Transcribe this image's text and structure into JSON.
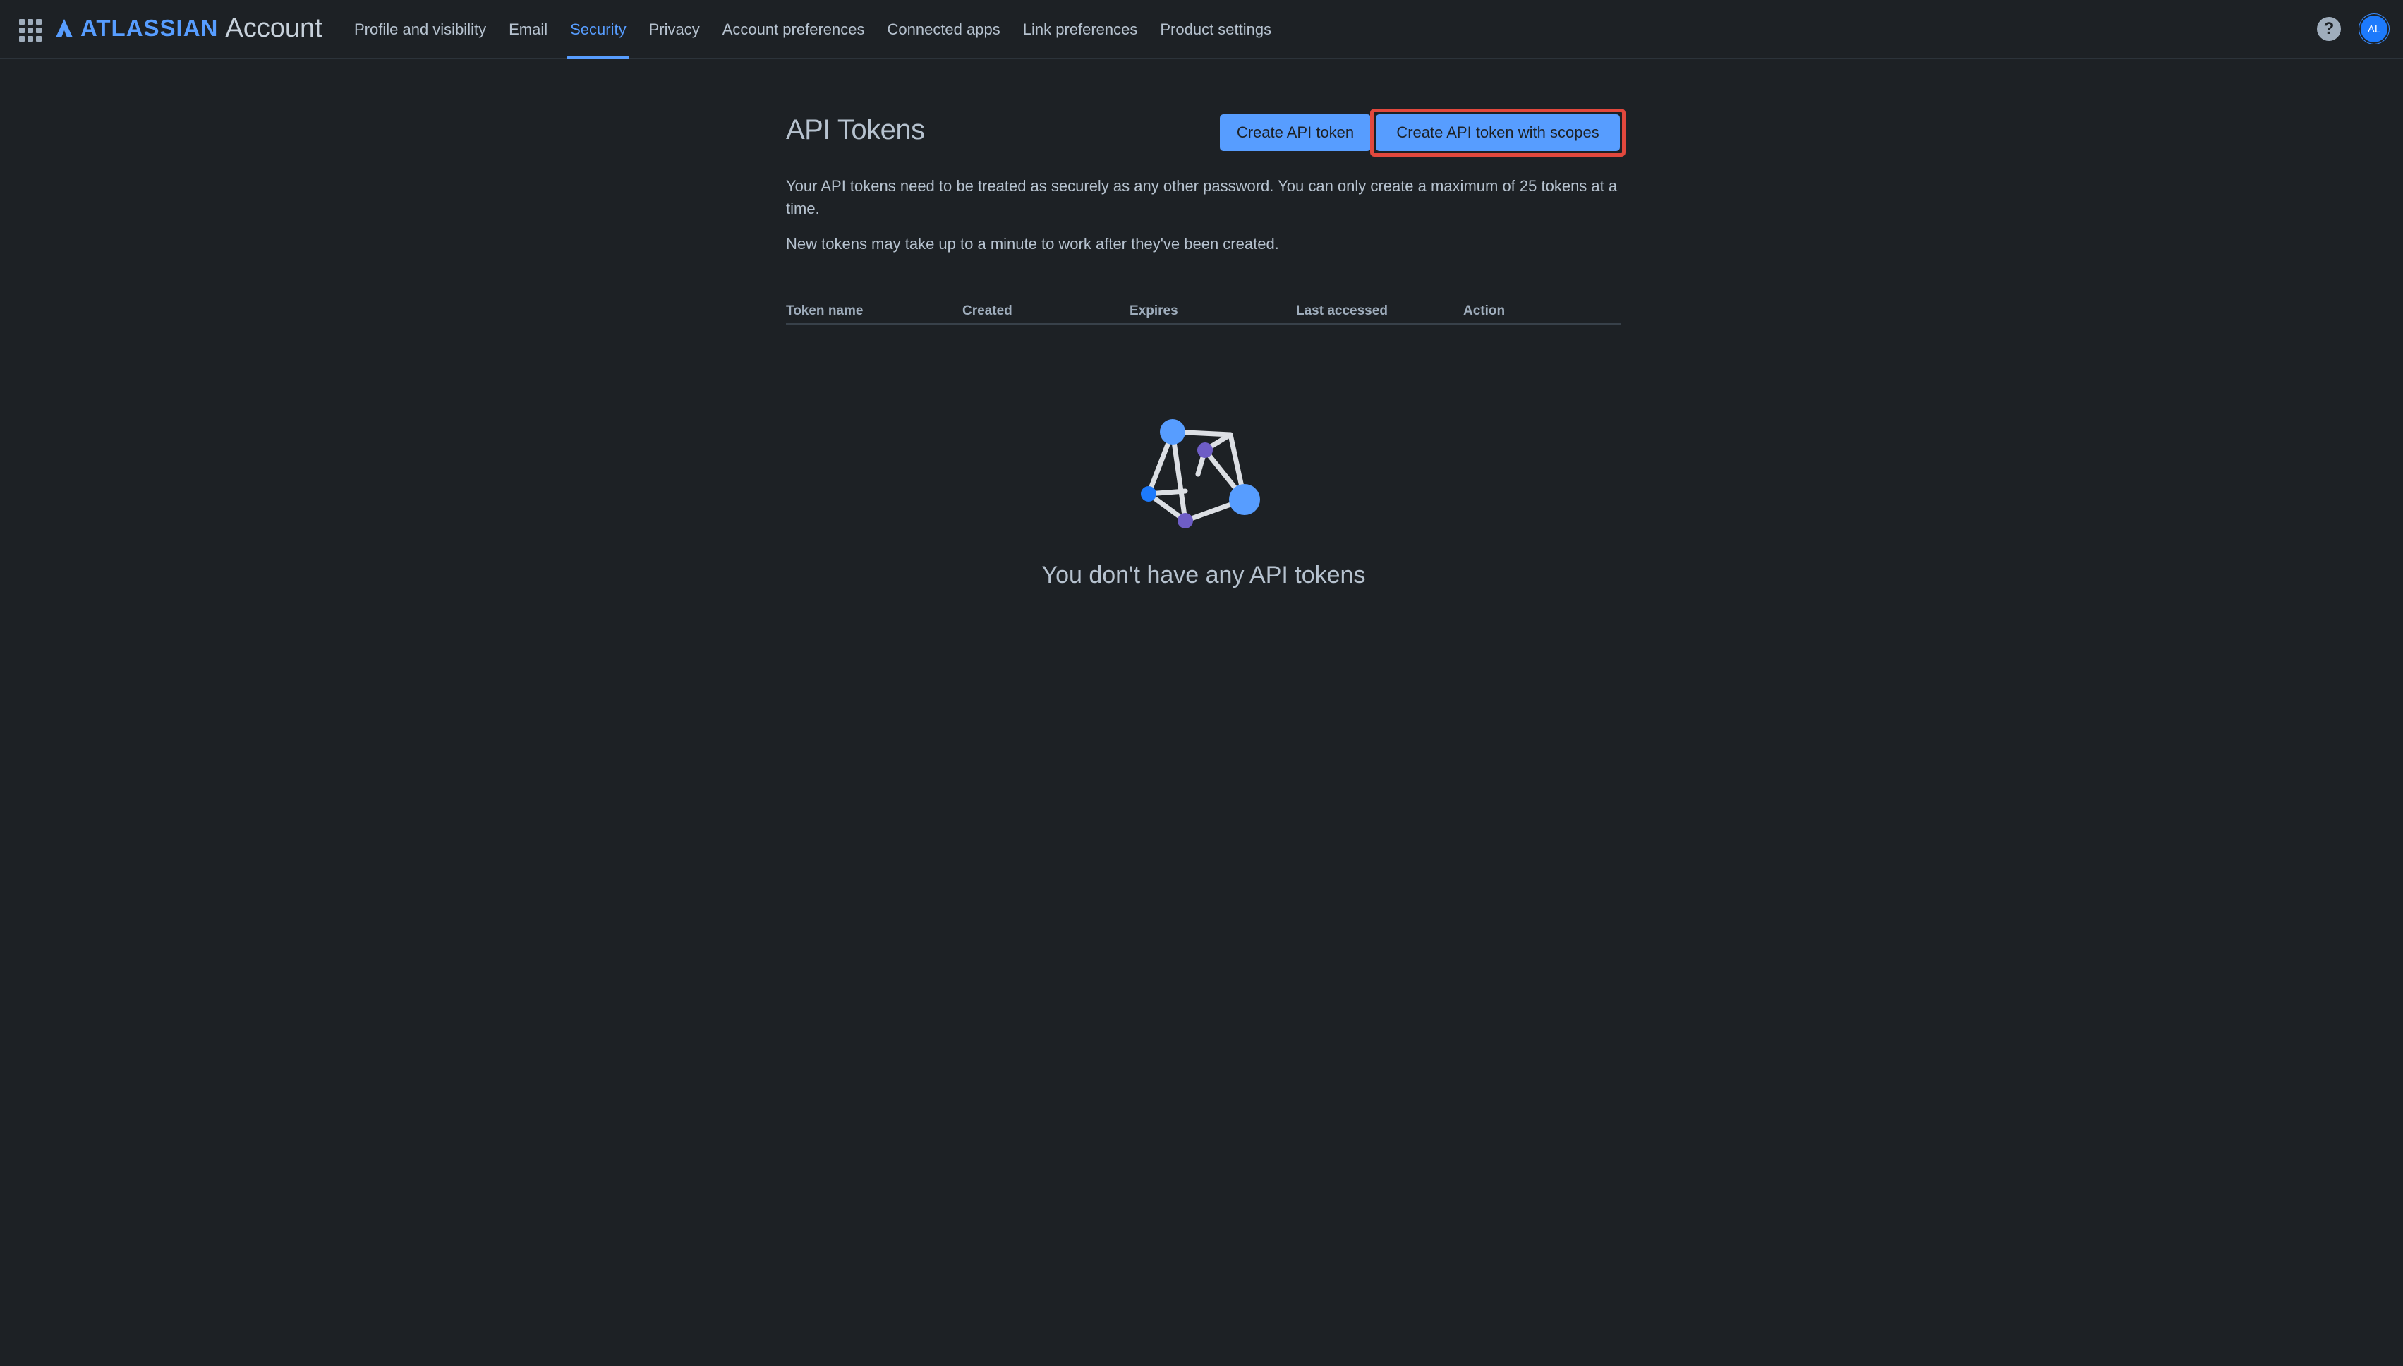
{
  "header": {
    "brand": "ATLASSIAN",
    "product": "Account",
    "app_switcher_icon": "app-switcher-grid-icon",
    "help_icon": "help-question-icon",
    "help_glyph": "?",
    "avatar_initials": "AL",
    "nav": [
      {
        "label": "Profile and visibility",
        "active": false
      },
      {
        "label": "Email",
        "active": false
      },
      {
        "label": "Security",
        "active": true
      },
      {
        "label": "Privacy",
        "active": false
      },
      {
        "label": "Account preferences",
        "active": false
      },
      {
        "label": "Connected apps",
        "active": false
      },
      {
        "label": "Link preferences",
        "active": false
      },
      {
        "label": "Product settings",
        "active": false
      }
    ]
  },
  "main": {
    "title": "API Tokens",
    "create_button": "Create API token",
    "create_scopes_button": "Create API token with scopes",
    "description": "Your API tokens need to be treated as securely as any other password. You can only create a maximum of 25 tokens at a time.",
    "note": "New tokens may take up to a minute to work after they've been created.",
    "table": {
      "columns": [
        "Token name",
        "Created",
        "Expires",
        "Last accessed",
        "Action"
      ],
      "rows": []
    },
    "empty_state": {
      "illustration": "network-nodes-illustration",
      "text": "You don't have any API tokens"
    }
  },
  "colors": {
    "background": "#1d2125",
    "accent": "#579dff",
    "text": "#b6c2cf",
    "highlight_border": "#e2483d",
    "node_blue": "#579dff",
    "node_purple": "#6e5dc6"
  }
}
